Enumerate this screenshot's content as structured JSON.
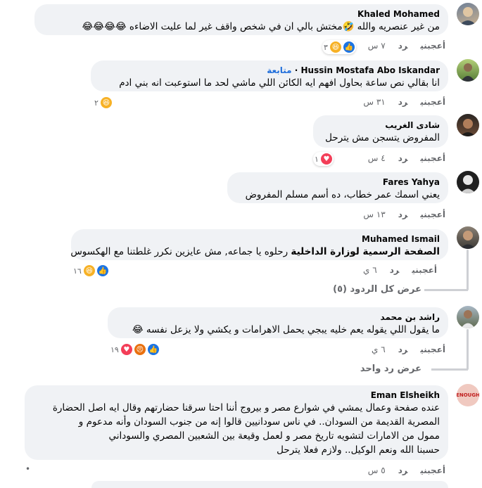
{
  "labels": {
    "like": "أعجبني",
    "reply": "رد"
  },
  "comments": [
    {
      "author": "Khaled Mohamed",
      "text": "من غير عنصريه والله 🤣مختش بالي ان في شخص واقف غير لما عليت الاضاءه 😂😂😂😂",
      "time": "٧ س",
      "reactions_count": "٣"
    },
    {
      "author": "Hussin Mostafa Abo Iskandar",
      "follow": "متابعة",
      "text": "انا بقالي نص ساعة بحاول افهم ايه الكائن اللي ماشي لحد ما استوعبت انه بني ادم",
      "time": "٣١ س",
      "reactions_count": "٢"
    },
    {
      "author": "شادى الغريب",
      "text": "المفروض يتسجن مش يترحل",
      "time": "٤ س",
      "reactions_count": "١"
    },
    {
      "author": "Fares Yahya",
      "text": "يعني اسمك عمر خطاب، ده أسم مسلم المفروض",
      "time": "١٣ س"
    },
    {
      "author": "Muhamed Ismail",
      "tag": "الصفحة الرسمية لوزارة الداخلية",
      "text": "رحلوه يا جماعه, مش عايزين نكرر غلطتنا مع الهكسوس",
      "time": "٦ ي",
      "reactions_count": "١٦",
      "view_replies": "عرض كل الردود (٥)"
    },
    {
      "author": "راشد بن محمد",
      "text": "ما يقول اللي يقوله يعم خليه يبجي يحمل الاهرامات و يكشي ولا يزعل نفسه 😂",
      "time": "٦ ي",
      "reactions_count": "١٩",
      "view_replies": "عرض رد واحد"
    },
    {
      "author": "Eman Elsheikh",
      "avatar_text": "ENOUGH",
      "lines": [
        "عنده صفحة وعمال يمشي في شوارع مصر و بيروج أننا احتا سرقنا حضارتهم وقال ايه اصل الحضارة",
        "المصرية القديمة من السودان.. في ناس سودانيين قالوا إنه من جنوب السودان وأنه مدعوم و",
        "ممول من الامارات لتشويه تاريخ مصر و لعمل وقيعة بين الشعبين المصري والسوداني",
        "حسبنا الله ونعم الوكيل.. ولازم فعلا يترحل"
      ],
      "time": "٥ س",
      "dot": "•"
    }
  ]
}
